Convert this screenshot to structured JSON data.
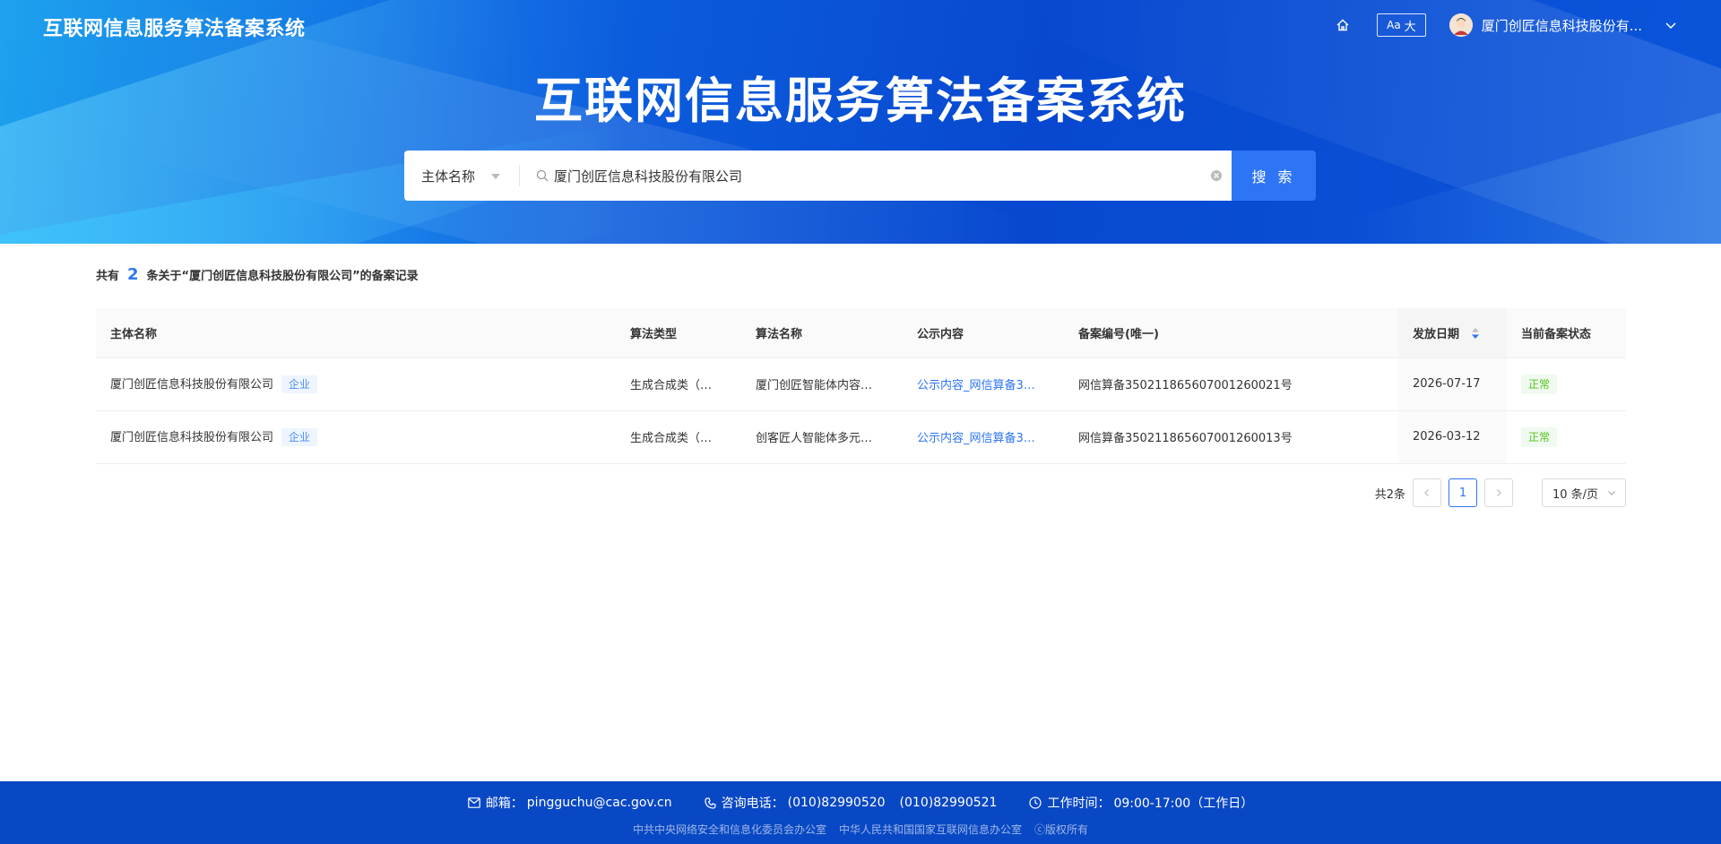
{
  "header": {
    "brand": "互联网信息服务算法备案系统",
    "font_toggle_small": "Aa",
    "font_toggle_big": "大",
    "user_name": "厦门创匠信息科技股份有...",
    "hero_title": "互联网信息服务算法备案系统"
  },
  "search": {
    "type_label": "主体名称",
    "value": "厦门创匠信息科技股份有限公司",
    "button_label": "搜 索"
  },
  "summary": {
    "prefix": "共有",
    "count": "2",
    "suffix": "条关于“厦门创匠信息科技股份有限公司”的备案记录"
  },
  "table": {
    "columns": [
      "主体名称",
      "算法类型",
      "算法名称",
      "公示内容",
      "备案编号(唯一)",
      "发放日期",
      "当前备案状态"
    ],
    "rows": [
      {
        "entity": "厦门创匠信息科技股份有限公司",
        "entity_tag": "企业",
        "algo_type": "生成合成类（…",
        "algo_name": "厦门创匠智能体内容…",
        "content_link": "公示内容_网信算备3…",
        "record_no": "网信算备350211865607001260021号",
        "date": "2026-07-17",
        "status": "正常"
      },
      {
        "entity": "厦门创匠信息科技股份有限公司",
        "entity_tag": "企业",
        "algo_type": "生成合成类（…",
        "algo_name": "创客匠人智能体多元…",
        "content_link": "公示内容_网信算备3…",
        "record_no": "网信算备350211865607001260013号",
        "date": "2026-03-12",
        "status": "正常"
      }
    ]
  },
  "pagination": {
    "total": "共2条",
    "current": "1",
    "page_size": "10 条/页"
  },
  "footer": {
    "email_label": "邮箱：",
    "email": "pingguchu@cac.gov.cn",
    "phone_label": "咨询电话：",
    "phone1": "(010)82990520",
    "phone2": "(010)82990521",
    "hours_label": "工作时间：",
    "hours": "09:00-17:00（工作日）",
    "org1": "中共中央网络安全和信息化委员会办公室",
    "org2": "中华人民共和国国家互联网信息办公室",
    "copyright": "ⓒ版权所有"
  },
  "colors": {
    "primary": "#2e75f6",
    "footer_bg": "#0948c4",
    "status_ok": "#52c41a"
  }
}
